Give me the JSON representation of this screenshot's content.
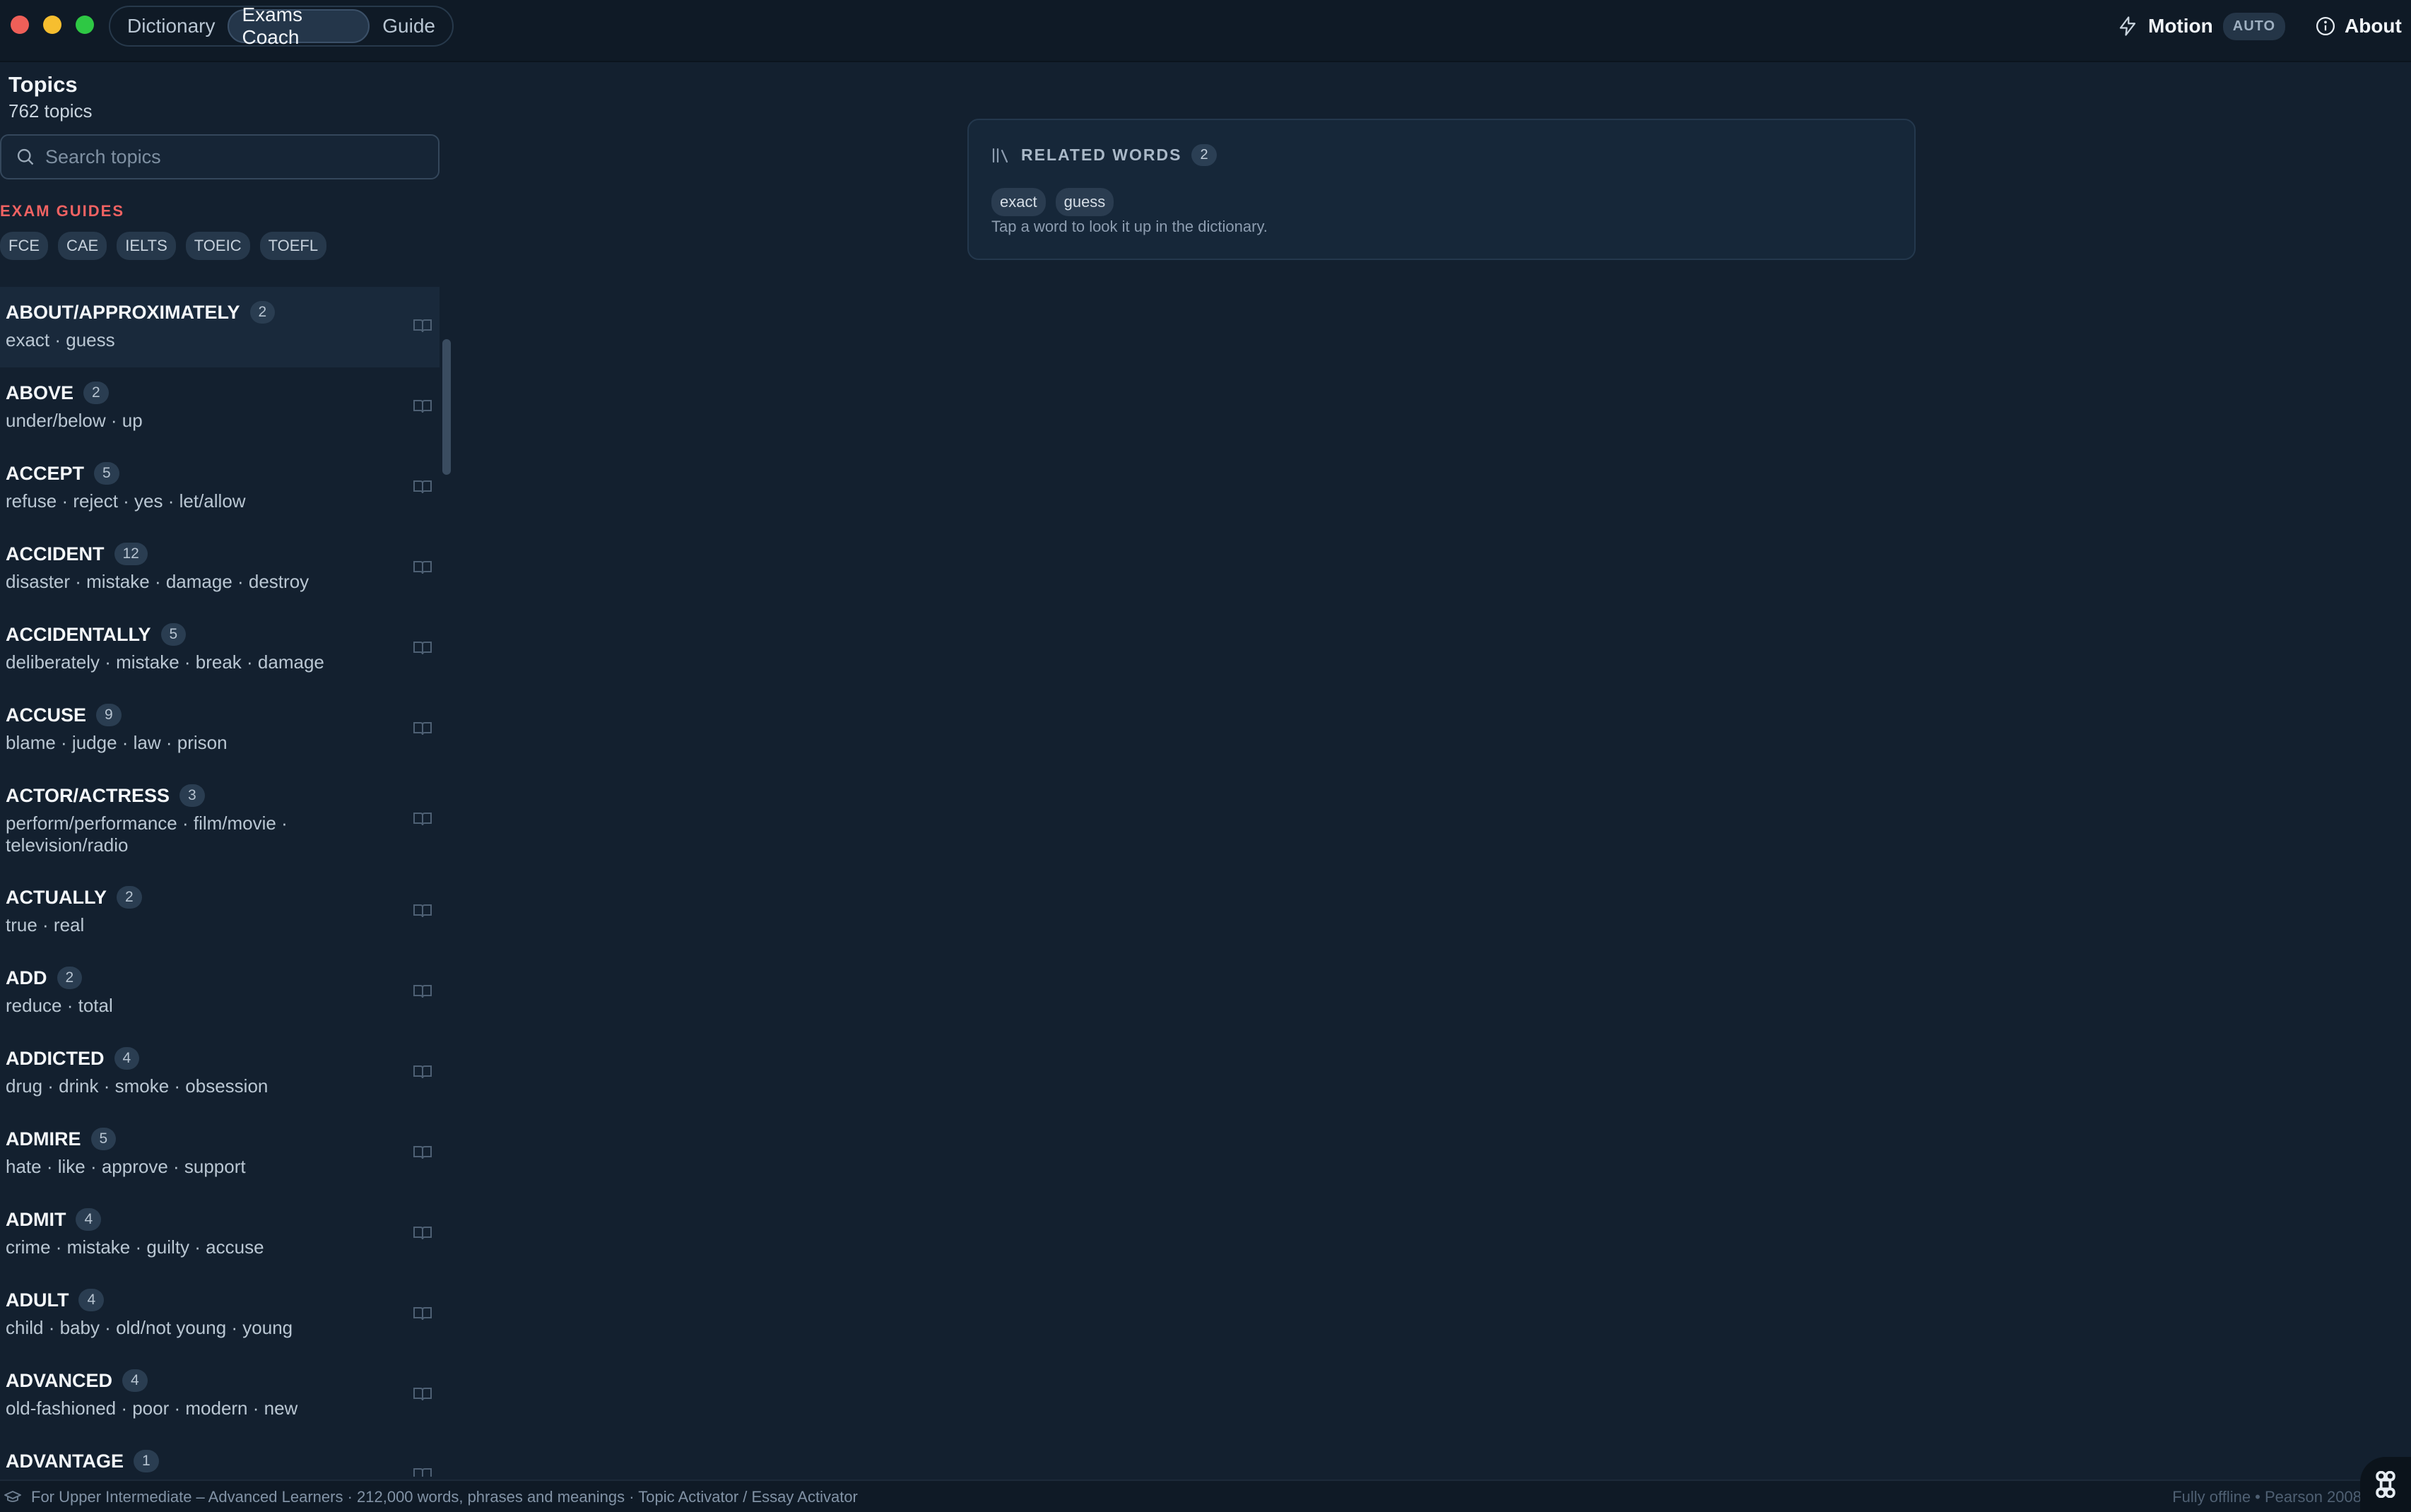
{
  "titlebar": {
    "tabs": [
      {
        "label": "Dictionary",
        "active": false
      },
      {
        "label": "Exams Coach",
        "active": true
      },
      {
        "label": "Guide",
        "active": false
      }
    ],
    "motion_label": "Motion",
    "motion_badge": "AUTO",
    "about_label": "About"
  },
  "sidebar": {
    "title": "Topics",
    "count": "762 topics",
    "search_placeholder": "Search topics",
    "exam_guides_heading": "EXAM GUIDES",
    "exam_guides": [
      "FCE",
      "CAE",
      "IELTS",
      "TOEIC",
      "TOEFL"
    ],
    "topics": [
      {
        "name": "ABOUT/APPROXIMATELY",
        "count": "2",
        "related": "exact · guess",
        "selected": true
      },
      {
        "name": "ABOVE",
        "count": "2",
        "related": "under/below · up"
      },
      {
        "name": "ACCEPT",
        "count": "5",
        "related": "refuse · reject · yes · let/allow"
      },
      {
        "name": "ACCIDENT",
        "count": "12",
        "related": "disaster · mistake · damage · destroy"
      },
      {
        "name": "ACCIDENTALLY",
        "count": "5",
        "related": "deliberately · mistake · break · damage"
      },
      {
        "name": "ACCUSE",
        "count": "9",
        "related": "blame · judge · law · prison"
      },
      {
        "name": "ACTOR/ACTRESS",
        "count": "3",
        "related": "perform/performance · film/movie · television/radio"
      },
      {
        "name": "ACTUALLY",
        "count": "2",
        "related": "true · real"
      },
      {
        "name": "ADD",
        "count": "2",
        "related": "reduce · total"
      },
      {
        "name": "ADDICTED",
        "count": "4",
        "related": "drug · drink · smoke · obsession"
      },
      {
        "name": "ADMIRE",
        "count": "5",
        "related": "hate · like · approve · support"
      },
      {
        "name": "ADMIT",
        "count": "4",
        "related": "crime · mistake · guilty · accuse"
      },
      {
        "name": "ADULT",
        "count": "4",
        "related": "child · baby · old/not young · young"
      },
      {
        "name": "ADVANCED",
        "count": "4",
        "related": "old-fashioned · poor · modern · new"
      },
      {
        "name": "ADVANTAGE",
        "count": "1",
        "related": ""
      }
    ]
  },
  "related_card": {
    "title": "RELATED WORDS",
    "count": "2",
    "words": [
      "exact",
      "guess"
    ],
    "hint": "Tap a word to look it up in the dictionary."
  },
  "footer": {
    "left_text": "For Upper Intermediate – Advanced Learners · 212,000 words, phrases and meanings · Topic Activator / Essay Activator",
    "right_text": "Fully offline • Pearson 2008"
  },
  "colors": {
    "background": "#13202f",
    "titlebar": "#0f1a26",
    "accent_red": "#f06262",
    "text_primary": "#f1f5f9",
    "text_secondary": "#bac7d3"
  }
}
